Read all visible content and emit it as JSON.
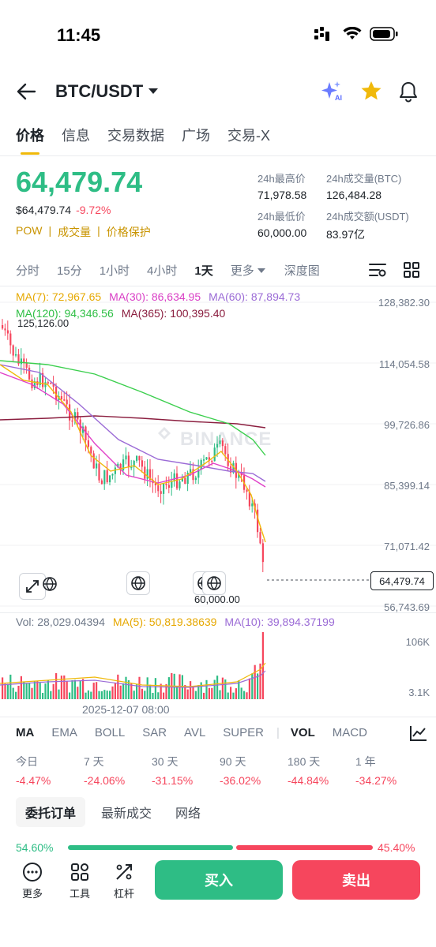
{
  "status_bar": {
    "time": "11:45"
  },
  "header": {
    "pair": "BTC/USDT",
    "ai_label": "AI"
  },
  "tabs": [
    "价格",
    "信息",
    "交易数据",
    "广场",
    "交易-X"
  ],
  "price": {
    "last": "64,479.74",
    "usd": "$64,479.74",
    "change": "-9.72%",
    "tags": [
      "POW",
      "成交量",
      "价格保护"
    ]
  },
  "stats": {
    "high_label": "24h最高价",
    "high": "71,978.58",
    "vol_btc_label": "24h成交量(BTC)",
    "vol_btc": "126,484.28",
    "low_label": "24h最低价",
    "low": "60,000.00",
    "vol_usdt_label": "24h成交额(USDT)",
    "vol_usdt": "83.97亿"
  },
  "intervals": [
    "分时",
    "15分",
    "1小时",
    "4小时",
    "1天",
    "更多",
    "深度图"
  ],
  "ma": {
    "ma7": "MA(7): 72,967.65",
    "ma30": "MA(30): 86,634.95",
    "ma60": "MA(60): 87,894.73",
    "ma120": "MA(120): 94,346.56",
    "ma365": "MA(365): 100,395.40"
  },
  "colors": {
    "up": "#2ebd85",
    "down": "#f6465d",
    "accent": "#f0b90b",
    "ma7": "#f0b90b",
    "ma30": "#e040c8",
    "ma60": "#9b6bd6",
    "ma120": "#3ccf4e",
    "ma365": "#8b1e3f"
  },
  "chart_labels": {
    "y_ticks": [
      "128,382.30",
      "114,054.58",
      "99,726.86",
      "85,399.14",
      "71,071.42",
      "56,743.69"
    ],
    "high_mark": "125,126.00",
    "low_mark": "60,000.00",
    "current": "64,479.74",
    "watermark": "BINANCE",
    "date": "2025-12-07 08:00"
  },
  "volume": {
    "vol": "Vol: 28,029.04394",
    "ma5": "MA(5): 50,819.38639",
    "ma10": "MA(10): 39,894.37199",
    "y_top": "106K",
    "y_bottom": "3.1K"
  },
  "indicator_tabs": [
    "MA",
    "EMA",
    "BOLL",
    "SAR",
    "AVL",
    "SUPER",
    "VOL",
    "MACD"
  ],
  "performance": [
    {
      "label": "今日",
      "value": "-4.47%"
    },
    {
      "label": "7 天",
      "value": "-24.06%"
    },
    {
      "label": "30 天",
      "value": "-31.15%"
    },
    {
      "label": "90 天",
      "value": "-36.02%"
    },
    {
      "label": "180 天",
      "value": "-44.84%"
    },
    {
      "label": "1 年",
      "value": "-34.27%"
    }
  ],
  "order_tabs": [
    "委托订单",
    "最新成交",
    "网络"
  ],
  "depth_ratio": {
    "buy": "54.60%",
    "sell": "45.40%"
  },
  "bottom_nav": {
    "more": "更多",
    "tools": "工具",
    "leverage": "杠杆",
    "buy": "买入",
    "sell": "卖出"
  }
}
